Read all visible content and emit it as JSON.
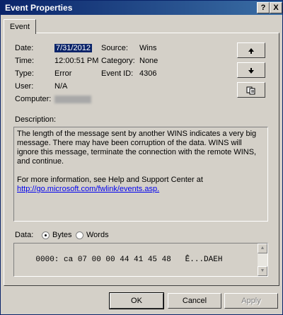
{
  "window": {
    "title": "Event Properties",
    "help_glyph": "?",
    "close_glyph": "X"
  },
  "tabs": [
    {
      "label": "Event"
    }
  ],
  "fields": {
    "date_label": "Date:",
    "date_value": "7/31/2012",
    "source_label": "Source:",
    "source_value": "Wins",
    "time_label": "Time:",
    "time_value": "12:00:51 PM",
    "category_label": "Category:",
    "category_value": "None",
    "type_label": "Type:",
    "type_value": "Error",
    "eventid_label": "Event ID:",
    "eventid_value": "4306",
    "user_label": "User:",
    "user_value": "N/A",
    "computer_label": "Computer:"
  },
  "side_buttons": {
    "up_icon": "arrow-up-icon",
    "down_icon": "arrow-down-icon",
    "copy_icon": "copy-icon"
  },
  "description": {
    "label": "Description:",
    "paragraph1": "The length of the message sent by another WINS indicates a very big message. There may have been corruption of the data. WINS will ignore this message, terminate the connection with the remote WINS, and continue.",
    "paragraph2": "For more information, see Help and Support Center at",
    "link": "http://go.microsoft.com/fwlink/events.asp."
  },
  "data": {
    "label": "Data:",
    "bytes_label": "Bytes",
    "words_label": "Words",
    "selected": "Bytes",
    "content": "0000: ca 07 00 00 44 41 45 48   Ê...DAEH"
  },
  "buttons": {
    "ok": "OK",
    "cancel": "Cancel",
    "apply": "Apply"
  }
}
